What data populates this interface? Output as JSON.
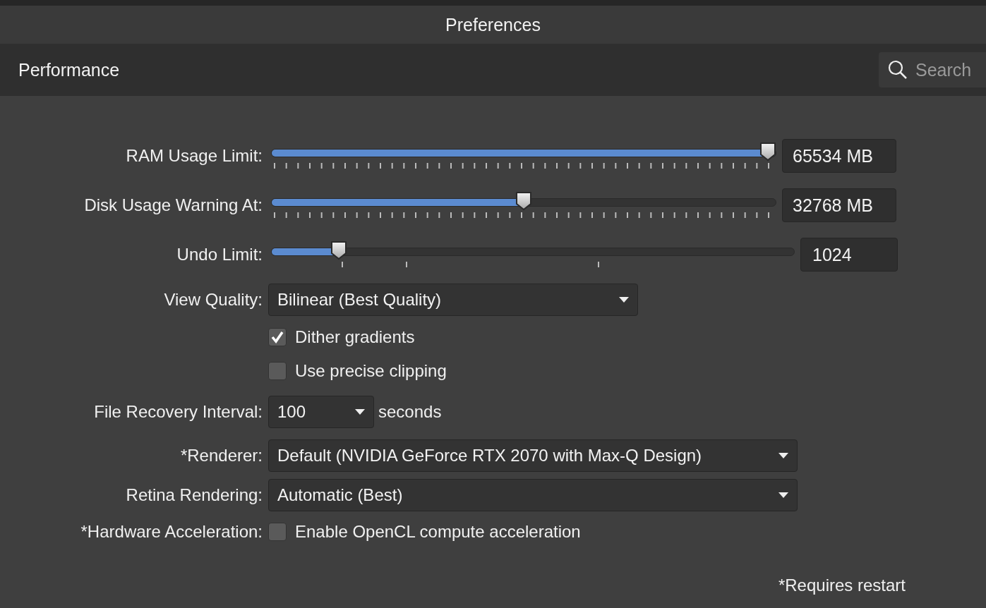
{
  "window": {
    "title": "Preferences"
  },
  "header": {
    "section": "Performance",
    "search": {
      "placeholder": "Search"
    }
  },
  "sliders": [
    {
      "label": "RAM Usage Limit:",
      "kind": "fine",
      "level": 1.0,
      "value": "65534 MB"
    },
    {
      "label": "Disk Usage Warning At:",
      "kind": "fine",
      "level": 0.5,
      "value": "32768 MB"
    },
    {
      "label": "Undo Limit:",
      "kind": "sparse",
      "level": 0.13,
      "value": "1024"
    }
  ],
  "view_quality": {
    "label": "View Quality:",
    "value": "Bilinear (Best Quality)"
  },
  "checkboxes": [
    {
      "label": "Dither gradients",
      "checked": true
    },
    {
      "label": "Use precise clipping",
      "checked": false
    }
  ],
  "file_recovery": {
    "label": "File Recovery Interval:",
    "value": "100",
    "unit": "seconds"
  },
  "renderer": {
    "label": "*Renderer:",
    "value": "Default (NVIDIA GeForce RTX 2070 with Max-Q Design)"
  },
  "retina": {
    "label": "Retina Rendering:",
    "value": "Automatic (Best)"
  },
  "hardware": {
    "label": "*Hardware Acceleration:",
    "option": "Enable OpenCL compute acceleration",
    "checked": false
  },
  "footnote": "*Requires restart"
}
